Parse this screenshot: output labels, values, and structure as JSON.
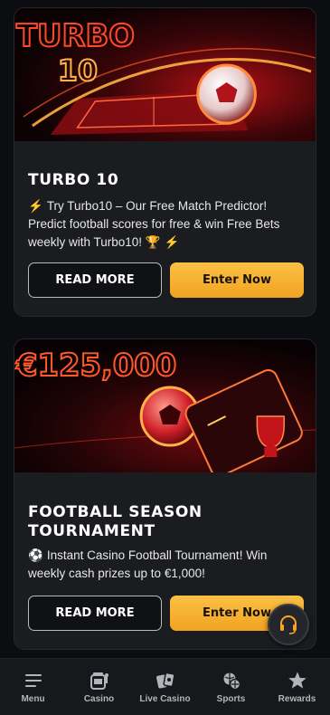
{
  "promos": [
    {
      "banner_text_line1": "TURBO",
      "banner_text_line2": "10",
      "title": "TURBO 10",
      "description": "Try Turbo10 – Our Free Match Predictor! Predict football scores for free & win Free Bets weekly with Turbo10!",
      "read_more_label": "READ MORE",
      "cta_label": "Enter Now"
    },
    {
      "banner_text": "€125,000",
      "title": "FOOTBALL SEASON TOURNAMENT",
      "description": "Instant Casino Football Tournament! Win weekly cash prizes up to €1,000!",
      "read_more_label": "READ MORE",
      "cta_label": "Enter Now"
    }
  ],
  "bottom_nav": {
    "items": [
      {
        "label": "Menu",
        "icon": "menu-icon"
      },
      {
        "label": "Casino",
        "icon": "slot-machine-icon"
      },
      {
        "label": "Live Casino",
        "icon": "playing-cards-icon"
      },
      {
        "label": "Sports",
        "icon": "sports-balls-icon"
      },
      {
        "label": "Rewards",
        "icon": "star-icon"
      }
    ]
  },
  "support_icon": "headset-icon",
  "colors": {
    "accent": "#f6a623",
    "background": "#0c0d10",
    "card": "#1b1c20",
    "nav": "#17181c"
  }
}
